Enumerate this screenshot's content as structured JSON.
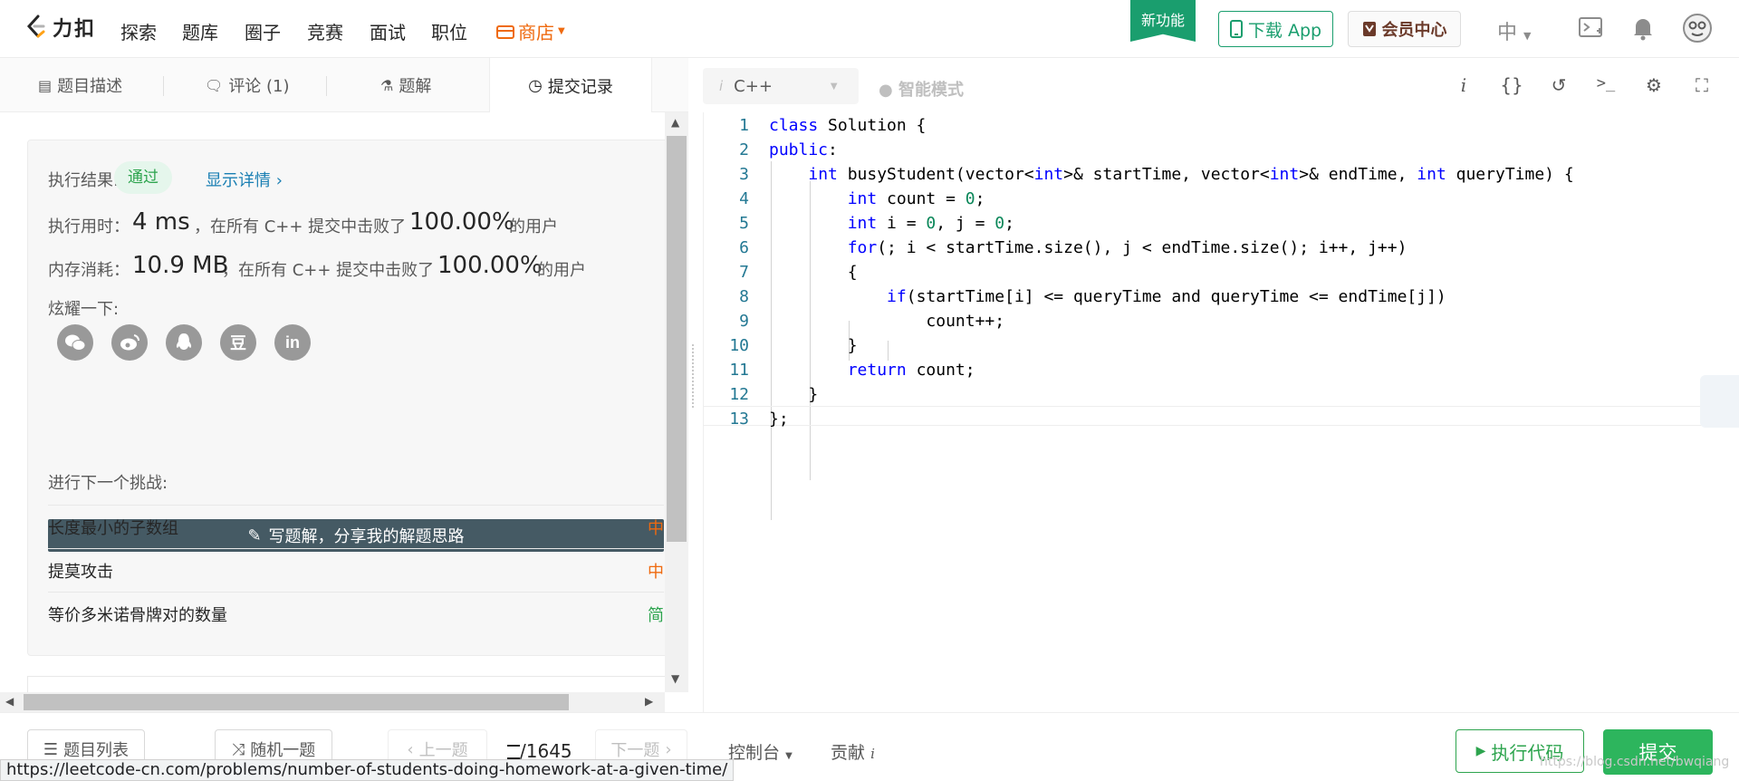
{
  "nav": {
    "logo_text": "力扣",
    "items": [
      "探索",
      "题库",
      "圈子",
      "竞赛",
      "面试",
      "职位"
    ],
    "store": "商店",
    "new_feature": "新功能",
    "download": "下载 App",
    "vip": "会员中心",
    "lang": "中"
  },
  "tabs": {
    "desc": "题目描述",
    "comments": "评论 (1)",
    "solutions": "题解",
    "submissions": "提交记录"
  },
  "editor_bar": {
    "language": "C++",
    "smart_mode": "智能模式",
    "info_icon_label": "i",
    "braces_icon_label": "{}"
  },
  "result": {
    "label_result": "执行结果:",
    "status": "通过",
    "details": "显示详情 ›",
    "label_time": "执行用时：",
    "time_value": "4 ms",
    "time_mid": "，在所有 C++ 提交中击败了",
    "time_pct": "100.00%",
    "users": "的用户",
    "label_mem": "内存消耗：",
    "mem_value": "10.9 MB",
    "mem_mid": "，在所有 C++ 提交中击败了",
    "mem_pct": "100.00%",
    "share_label": "炫耀一下:",
    "share_icons": [
      "wechat-icon",
      "weibo-icon",
      "qq-icon",
      "douban-icon",
      "linkedin-icon"
    ],
    "share_glyph_douban": "豆",
    "share_glyph_linkedin": "in",
    "write_solution": "写题解，分享我的解题思路",
    "next_label": "进行下一个挑战:",
    "challenges": [
      {
        "title": "长度最小的子数组",
        "difficulty": "中",
        "color": "#ef6a0f"
      },
      {
        "title": "提莫攻击",
        "difficulty": "中",
        "color": "#ef6a0f"
      },
      {
        "title": "等价多米诺骨牌对的数量",
        "difficulty": "简",
        "color": "#2da44e"
      }
    ]
  },
  "code": {
    "line_numbers": [
      "1",
      "2",
      "3",
      "4",
      "5",
      "6",
      "7",
      "8",
      "9",
      "10",
      "11",
      "12",
      "13"
    ]
  },
  "bottom": {
    "problem_list": "题目列表",
    "random": "随机一题",
    "prev": "上一题",
    "page": "/1645",
    "next": "下一题",
    "console": "控制台",
    "contribute": "贡献",
    "run": "执行代码",
    "submit": "提交"
  },
  "status_url": "https://leetcode-cn.com/problems/number-of-students-doing-homework-at-a-given-time/",
  "watermark": "https://blog.csdn.net/bwqiang"
}
